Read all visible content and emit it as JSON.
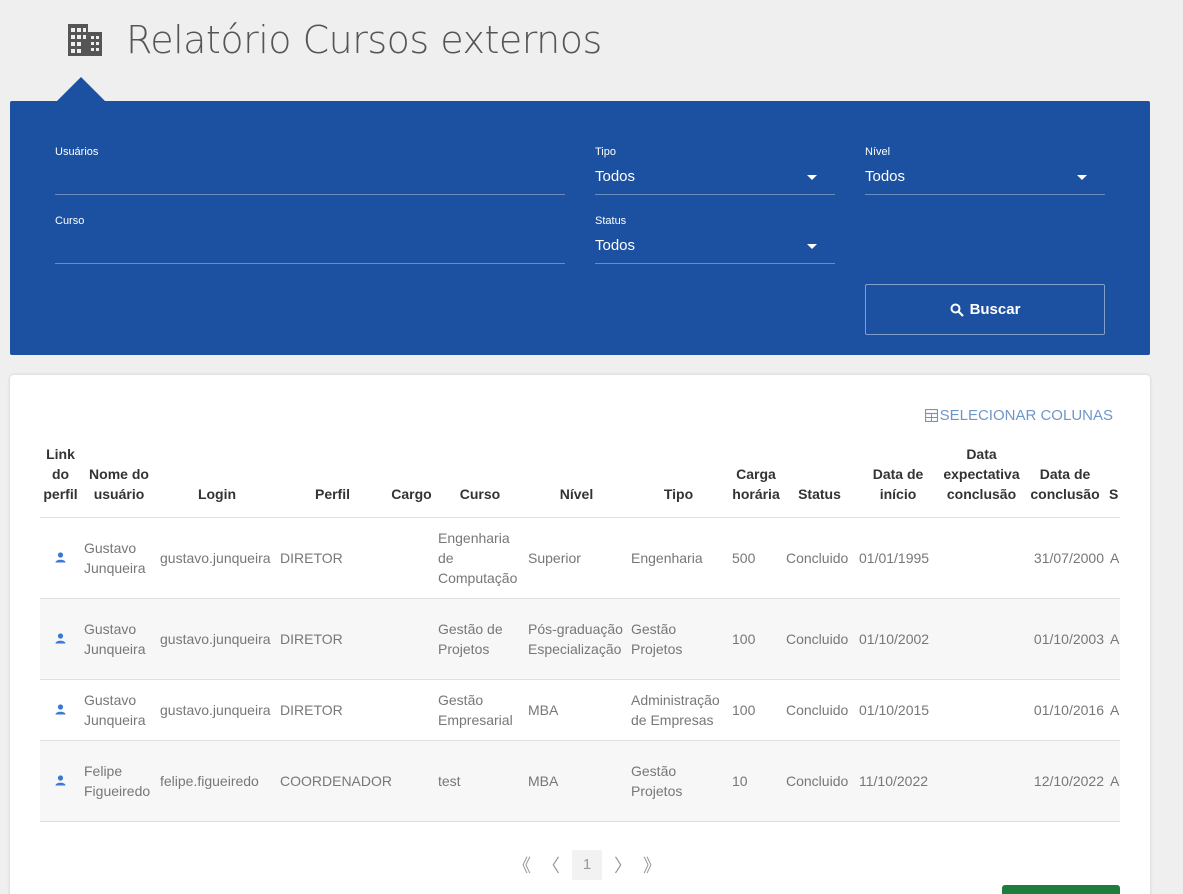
{
  "header": {
    "title": "Relatório Cursos externos",
    "icon": "building-icon"
  },
  "filters": {
    "usuarios": {
      "label": "Usuários",
      "value": ""
    },
    "tipo": {
      "label": "Tipo",
      "value": "Todos"
    },
    "nivel": {
      "label": "Nível",
      "value": "Todos"
    },
    "curso": {
      "label": "Curso",
      "value": ""
    },
    "status": {
      "label": "Status",
      "value": "Todos"
    },
    "search_label": "Buscar"
  },
  "table": {
    "select_columns_label": "SELECIONAR COLUNAS",
    "headers": {
      "link": "Link do perfil",
      "nome": "Nome do usuário",
      "login": "Login",
      "perfil": "Perfil",
      "cargo": "Cargo",
      "curso": "Curso",
      "nivel": "Nível",
      "tipo": "Tipo",
      "carga": "Carga horária",
      "status": "Status",
      "inicio": "Data de início",
      "expectativa": "Data expectativa conclusão",
      "conclusao": "Data de conclusão",
      "extra": "S"
    },
    "rows": [
      {
        "nome": "Gustavo Junqueira",
        "login": "gustavo.junqueira",
        "perfil": "DIRETOR",
        "cargo": "",
        "curso": "Engenharia de Computação",
        "nivel": "Superior",
        "tipo": "Engenharia",
        "carga": "500",
        "status": "Concluido",
        "inicio": "01/01/1995",
        "expectativa": "",
        "conclusao": "31/07/2000",
        "extra": "A"
      },
      {
        "nome": "Gustavo Junqueira",
        "login": "gustavo.junqueira",
        "perfil": "DIRETOR",
        "cargo": "",
        "curso": "Gestão de Projetos",
        "nivel": "Pós-graduação Especialização",
        "tipo": "Gestão Projetos",
        "carga": "100",
        "status": "Concluido",
        "inicio": "01/10/2002",
        "expectativa": "",
        "conclusao": "01/10/2003",
        "extra": "A"
      },
      {
        "nome": "Gustavo Junqueira",
        "login": "gustavo.junqueira",
        "perfil": "DIRETOR",
        "cargo": "",
        "curso": "Gestão Empresarial",
        "nivel": "MBA",
        "tipo": "Administração de Empresas",
        "carga": "100",
        "status": "Concluido",
        "inicio": "01/10/2015",
        "expectativa": "",
        "conclusao": "01/10/2016",
        "extra": "A"
      },
      {
        "nome": "Felipe Figueiredo",
        "login": "felipe.figueiredo",
        "perfil": "COORDENADOR",
        "cargo": "",
        "curso": "test",
        "nivel": "MBA",
        "tipo": "Gestão Projetos",
        "carga": "10",
        "status": "Concluido",
        "inicio": "11/10/2022",
        "expectativa": "",
        "conclusao": "12/10/2022",
        "extra": "A"
      }
    ]
  },
  "pagination": {
    "first": "《",
    "prev": "〈",
    "current": "1",
    "next": "〉",
    "last": "》"
  },
  "colors": {
    "panel": "#1b51a0",
    "accent_link": "#6f96c9",
    "profile_icon": "#3a78d8",
    "green_button": "#1e7d3a"
  }
}
